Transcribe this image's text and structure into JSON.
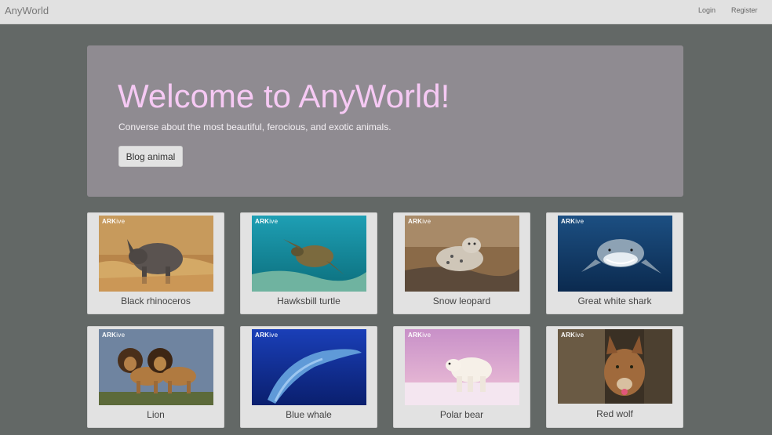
{
  "navbar": {
    "brand": "AnyWorld",
    "login": "Login",
    "register": "Register"
  },
  "jumbotron": {
    "title": "Welcome to AnyWorld!",
    "subtitle": "Converse about the most beautiful, ferocious, and exotic animals.",
    "button_label": "Blog animal"
  },
  "watermark": {
    "bold": "ARK",
    "light": "ive"
  },
  "animals": [
    {
      "name": "Black rhinoceros",
      "image": "rhinoceros-photo"
    },
    {
      "name": "Hawksbill turtle",
      "image": "turtle-photo"
    },
    {
      "name": "Snow leopard",
      "image": "leopard-photo"
    },
    {
      "name": "Great white shark",
      "image": "shark-photo"
    },
    {
      "name": "Lion",
      "image": "lion-photo"
    },
    {
      "name": "Blue whale",
      "image": "whale-photo"
    },
    {
      "name": "Polar bear",
      "image": "polar-bear-photo"
    },
    {
      "name": "Red wolf",
      "image": "wolf-photo"
    }
  ],
  "colors": {
    "page_background": "#636866",
    "jumbotron_background": "#8f8b91",
    "title_color": "#f6c9f4",
    "card_background": "#e2e2e2"
  }
}
